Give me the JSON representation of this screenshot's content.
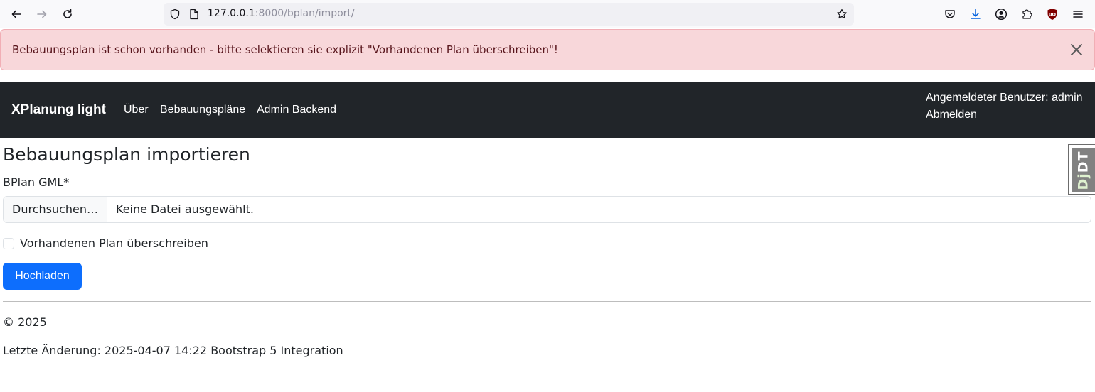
{
  "browser": {
    "url_host": "127.0.0.1",
    "url_rest": ":8000/bplan/import/"
  },
  "alert": {
    "message": "Bebauungsplan ist schon vorhanden - bitte selektieren sie explizit \"Vorhandenen Plan überschreiben\"!",
    "bg_color": "#f8d7da"
  },
  "navbar": {
    "brand": "XPlanung light",
    "links": [
      "Über",
      "Bebauungspläne",
      "Admin Backend"
    ],
    "user_label": "Angemeldeter Benutzer: admin",
    "logout_label": "Abmelden",
    "bg_color": "#212529"
  },
  "djdt": {
    "label_dj": "Dj",
    "label_dt": "DT"
  },
  "main": {
    "title": "Bebauungsplan importieren",
    "file_field_label": "BPlan GML*",
    "file_button_label": "Durchsuchen…",
    "file_status": "Keine Datei ausgewählt.",
    "overwrite_label": "Vorhandenen Plan überschreiben",
    "overwrite_checked": false,
    "submit_label": "Hochladen",
    "accent_color": "#0d6efd"
  },
  "footer": {
    "copyright": "© 2025",
    "last_change": "Letzte Änderung: 2025-04-07 14:22 Bootstrap 5 Integration"
  }
}
